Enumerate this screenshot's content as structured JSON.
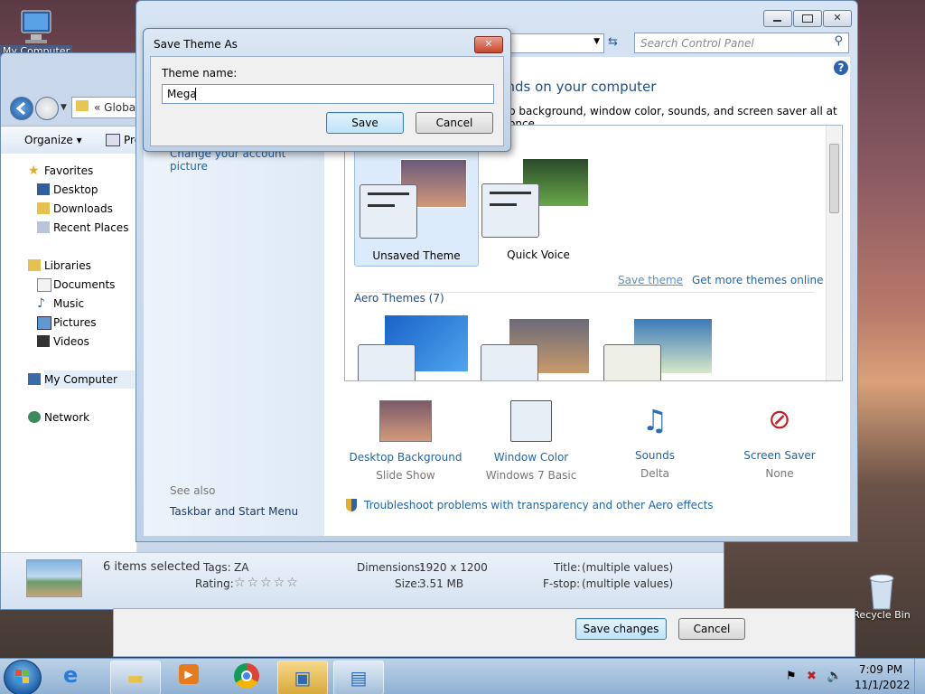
{
  "desktop": {
    "icons": [
      {
        "label": "My Computer"
      },
      {
        "label": "Recycle Bin"
      }
    ]
  },
  "explorer": {
    "address_crumb": "«  Global",
    "toolbar": {
      "organize": "Organize ▾",
      "second": "Pre"
    },
    "nav": {
      "favorites": "Favorites",
      "desktop": "Desktop",
      "downloads": "Downloads",
      "recent": "Recent Places",
      "libraries": "Libraries",
      "documents": "Documents",
      "music": "Music",
      "pictures": "Pictures",
      "videos": "Videos",
      "mycomputer": "My Computer",
      "network": "Network"
    },
    "status": {
      "selected": "6 items selected",
      "tags_label": "Tags:",
      "tags_value": "ZA",
      "rating_label": "Rating:",
      "rating_stars": "☆☆☆☆☆",
      "dimensions_label": "Dimensions:",
      "dimensions_value": "1920 x 1200",
      "size_label": "Size:",
      "size_value": "3.51 MB",
      "title_label": "Title:",
      "title_value": "(multiple values)",
      "fstop_label": "F-stop:",
      "fstop_value": "(multiple values)"
    },
    "save_changes": "Save changes",
    "cancel": "Cancel"
  },
  "control_panel": {
    "search_placeholder": "Search Control Panel",
    "heading": "unds on your computer",
    "subheading": "p background, window color, sounds, and screen saver all at once.",
    "left_link": "Change your account picture",
    "see_also": "See also",
    "taskbar_link": "Taskbar and Start Menu",
    "themes": {
      "unsaved": "Unsaved Theme",
      "quick_voice": "Quick Voice",
      "save_theme": "Save theme",
      "get_more": "Get more themes online",
      "aero_heading": "Aero Themes (7)"
    },
    "options": [
      {
        "title": "Desktop Background",
        "sub": "Slide Show"
      },
      {
        "title": "Window Color",
        "sub": "Windows 7 Basic"
      },
      {
        "title": "Sounds",
        "sub": "Delta"
      },
      {
        "title": "Screen Saver",
        "sub": "None"
      }
    ],
    "troubleshoot": "Troubleshoot problems with transparency and other Aero effects"
  },
  "dialog": {
    "title": "Save Theme As",
    "label": "Theme name:",
    "value": "Mega",
    "save": "Save",
    "cancel": "Cancel"
  },
  "taskbar": {
    "time": "7:09 PM",
    "date": "11/1/2022"
  },
  "colors": {
    "accent": "#1e66aa",
    "taskbar": "#9fbddc"
  }
}
